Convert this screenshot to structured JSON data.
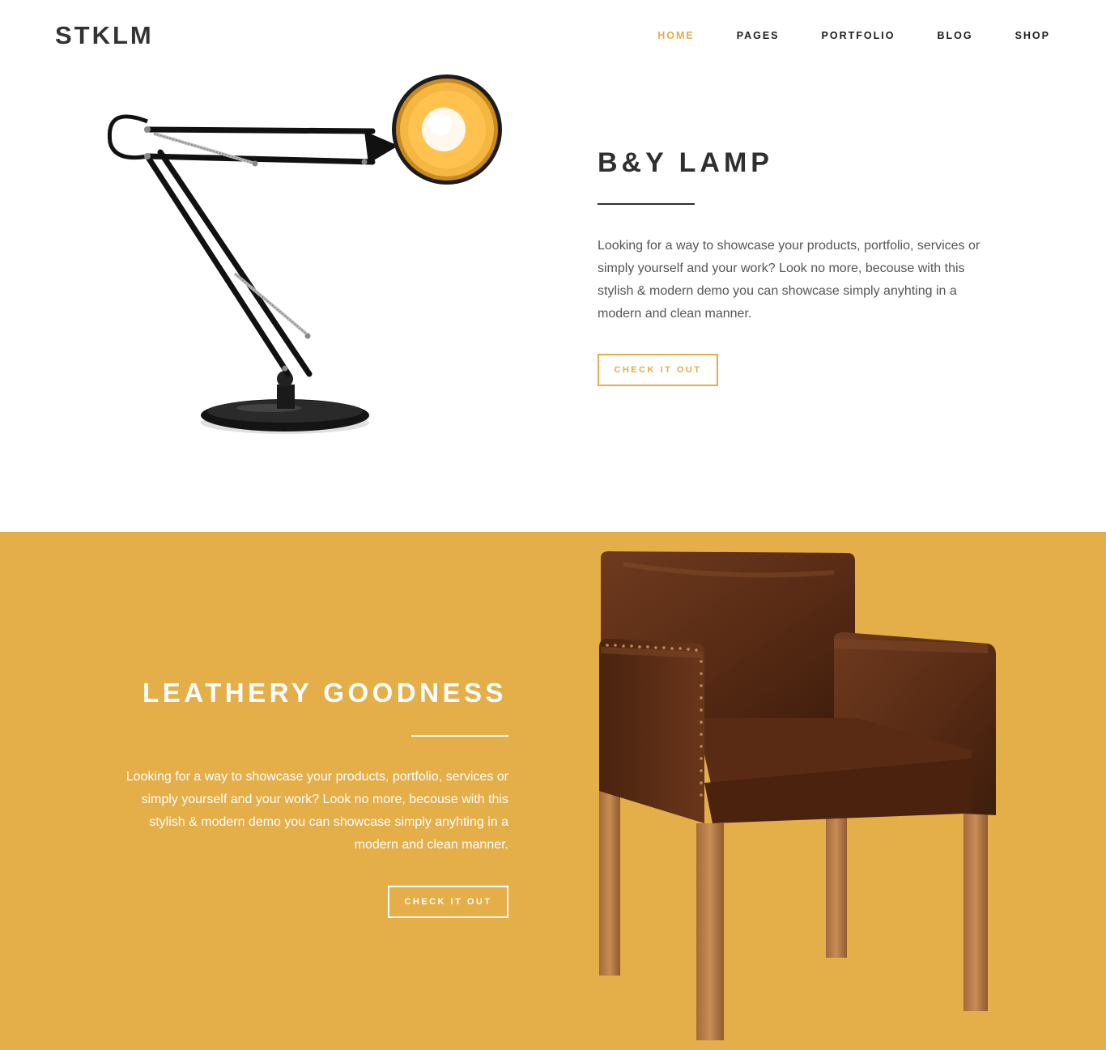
{
  "header": {
    "logo": "STKLM",
    "nav": [
      {
        "label": "HOME",
        "active": true
      },
      {
        "label": "PAGES",
        "active": false
      },
      {
        "label": "PORTFOLIO",
        "active": false
      },
      {
        "label": "BLOG",
        "active": false
      },
      {
        "label": "SHOP",
        "active": false
      }
    ]
  },
  "section1": {
    "title": "B&Y LAMP",
    "text": "Looking for a way to showcase your products, portfolio, services or simply yourself and your work? Look no more, becouse with this stylish & modern demo you can showcase simply anyhting in a modern and clean manner.",
    "button": "CHECK IT OUT",
    "image": "desk-lamp"
  },
  "section2": {
    "title": "LEATHERY GOODNESS",
    "text": "Looking for a way to showcase your products, portfolio, services or simply yourself and your work? Look no more, becouse with this stylish & modern demo you can showcase simply anyhting in a modern and clean manner.",
    "button": "CHECK IT OUT",
    "image": "leather-armchair"
  },
  "colors": {
    "accent": "#e3ad48",
    "section2_bg": "#e4ae48",
    "text_dark": "#2f2f2f"
  }
}
